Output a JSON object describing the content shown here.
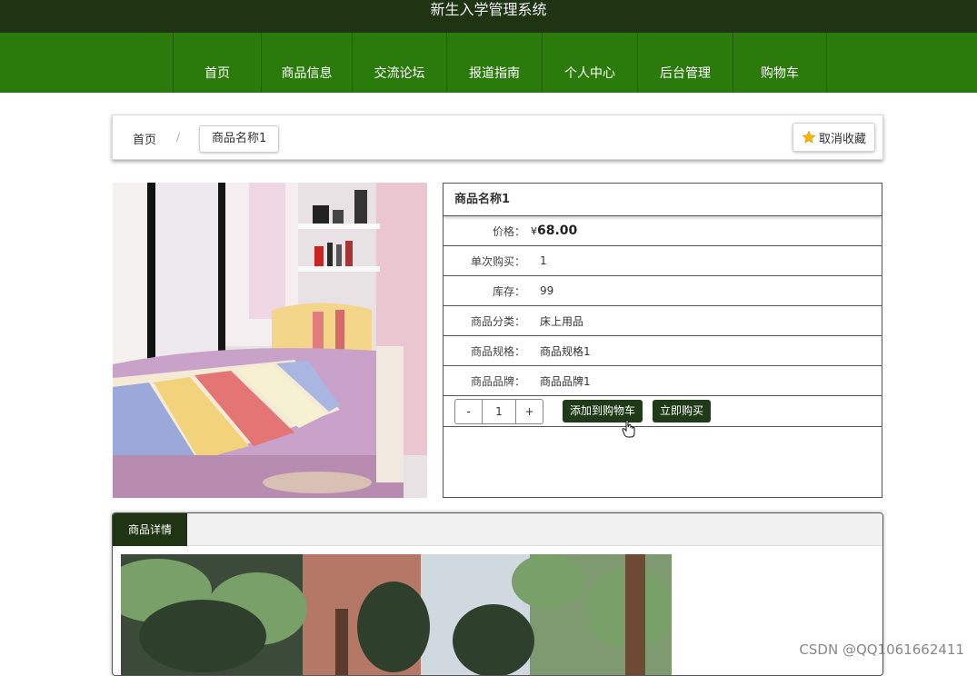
{
  "header": {
    "site_title": "新生入学管理系统"
  },
  "nav": {
    "items": [
      {
        "label": "首页"
      },
      {
        "label": "商品信息"
      },
      {
        "label": "交流论坛"
      },
      {
        "label": "报道指南"
      },
      {
        "label": "个人中心"
      },
      {
        "label": "后台管理"
      },
      {
        "label": "购物车"
      }
    ]
  },
  "breadcrumb": {
    "home": "首页",
    "separator": "/",
    "current": "商品名称1"
  },
  "favorite": {
    "label": "取消收藏",
    "icon": "star-icon"
  },
  "product": {
    "name": "商品名称1",
    "price_label": "价格：",
    "price_currency": "¥",
    "price_value": "68.00",
    "rows": [
      {
        "label": "单次购买：",
        "value": "1"
      },
      {
        "label": "库存：",
        "value": "99"
      },
      {
        "label": "商品分类：",
        "value": "床上用品"
      },
      {
        "label": "商品规格：",
        "value": "商品规格1"
      },
      {
        "label": "商品品牌：",
        "value": "商品品牌1"
      }
    ]
  },
  "actions": {
    "minus": "-",
    "quantity": "1",
    "plus": "+",
    "add_to_cart": "添加到购物车",
    "buy_now": "立即购买"
  },
  "detail": {
    "tab_label": "商品详情"
  },
  "watermark": "CSDN @QQ1061662411",
  "colors": {
    "nav_green": "#2a7a0c",
    "header_dark": "#1e3412",
    "button_dark": "#1e3a17"
  }
}
